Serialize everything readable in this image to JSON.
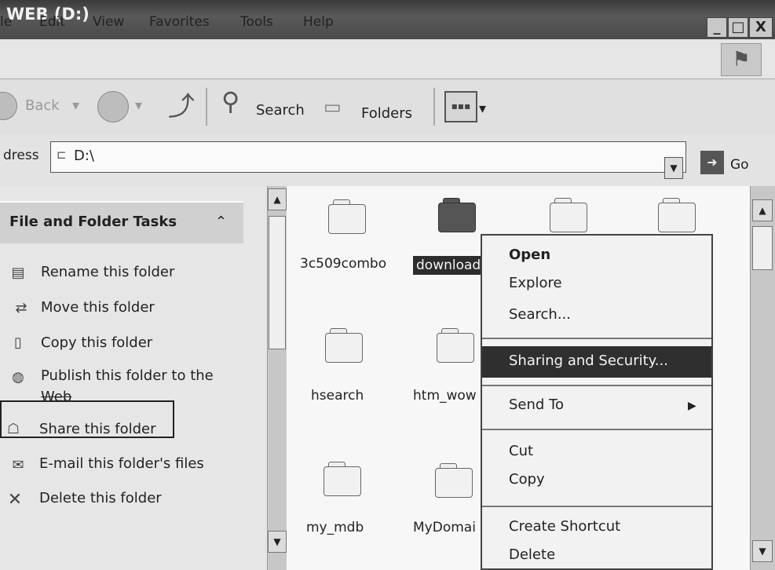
{
  "window": {
    "title": "WEB (D:)"
  },
  "title_buttons": {
    "minimize": "_",
    "maximize": "□",
    "close": "X"
  },
  "menu": [
    "le",
    "Edit",
    "View",
    "Favorites",
    "Tools",
    "Help"
  ],
  "toolbar": {
    "back": "Back",
    "search": "Search",
    "folders": "Folders"
  },
  "address": {
    "label": "dress",
    "value": "D:\\",
    "go": "Go"
  },
  "tasks": {
    "title": "File and Folder Tasks",
    "items": [
      {
        "label": "Rename this folder",
        "icon": "rename-icon"
      },
      {
        "label": "Move this folder",
        "icon": "move-icon"
      },
      {
        "label": "Copy this folder",
        "icon": "copy-icon"
      },
      {
        "label": "Publish this folder to the",
        "label2": "Web",
        "icon": "globe-icon"
      },
      {
        "label": "Share this folder",
        "icon": "share-icon"
      },
      {
        "label": "E-mail this folder's files",
        "icon": "email-icon"
      },
      {
        "label": "Delete this folder",
        "icon": "delete-icon"
      }
    ]
  },
  "folders": [
    {
      "label": "3c509combo"
    },
    {
      "label": "download"
    },
    {
      "label": "hsearch"
    },
    {
      "label": "htm_wow"
    },
    {
      "label": "my_mdb"
    },
    {
      "label": "MyDomai"
    }
  ],
  "context_menu": {
    "open": "Open",
    "explore": "Explore",
    "search": "Search...",
    "sharing": "Sharing and Security...",
    "send_to": "Send To",
    "cut": "Cut",
    "copy": "Copy",
    "create_shortcut": "Create Shortcut",
    "delete": "Delete"
  }
}
